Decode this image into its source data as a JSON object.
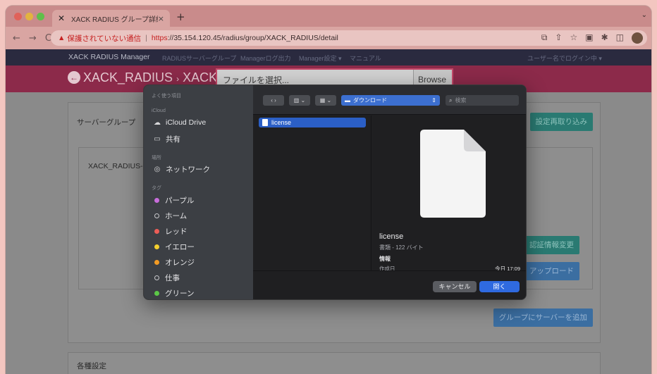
{
  "browser": {
    "tab_title": "XACK RADIUS グループ詳細",
    "new_tab": "+",
    "tab_close": "×",
    "tab_menu": "⌄",
    "nav_back": "←",
    "nav_forward": "→",
    "nav_reload": "C",
    "security_warning": "保護されていない通信",
    "url_scheme": "https",
    "url_rest": "://35.154.120.45/radius/group/XACK_RADIUS/detail"
  },
  "app": {
    "brand": "XACK RADIUS Manager",
    "nav_items": [
      "RADIUSサーバーグループ",
      "Managerログ出力",
      "Manager設定 ▾",
      "マニュアル"
    ],
    "nav_right": "ユーザー名でログイン中 ▾",
    "page_title": "XACK_RADIUS",
    "panel1_title": "サーバーグループ",
    "panel1_inner": "XACK_RADIUS-",
    "reload_button": "設定再取り込み",
    "auth_button": "認証情報変更",
    "upload_button": "アップロード",
    "add_server_button": "グループにサーバーを追加",
    "panel2_title": "各種設定"
  },
  "file_input": {
    "placeholder": "ファイルを選択...",
    "browse": "Browse"
  },
  "dialog": {
    "sidebar": {
      "favorites_header": "よく使う項目",
      "icloud_header": "iCloud",
      "icloud_drive": "iCloud Drive",
      "shared": "共有",
      "locations_header": "場所",
      "network": "ネットワーク",
      "tags_header": "タグ",
      "tags": [
        {
          "label": "パープル",
          "color": "#c86ddb"
        },
        {
          "label": "ホーム",
          "color": "hollow"
        },
        {
          "label": "レッド",
          "color": "#ec5d57"
        },
        {
          "label": "イエロー",
          "color": "#f4cf2e"
        },
        {
          "label": "オレンジ",
          "color": "#f39b24"
        },
        {
          "label": "仕事",
          "color": "hollow"
        },
        {
          "label": "グリーン",
          "color": "#5cc847"
        }
      ]
    },
    "toolbar": {
      "location": "ダウンロード",
      "search_placeholder": "検索"
    },
    "file": {
      "name": "license",
      "kind": "書類 - 122 バイト",
      "info_label": "情報",
      "created_label": "作成日",
      "created_value": "今日 17:09"
    },
    "cancel_button": "キャンセル",
    "open_button": "開く"
  }
}
